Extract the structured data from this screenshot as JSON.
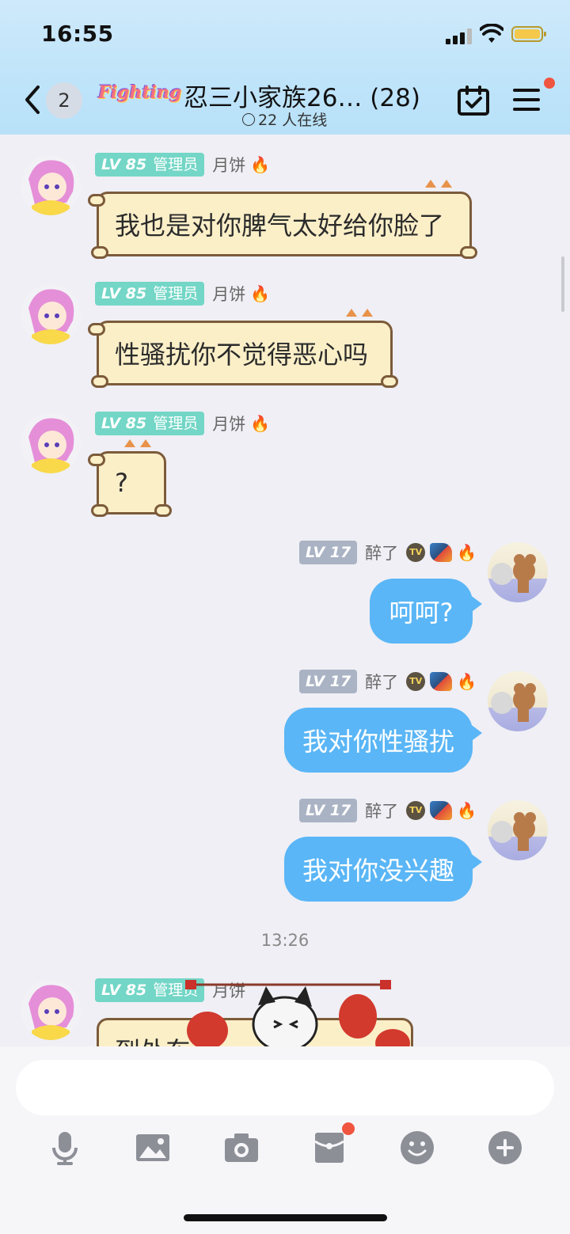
{
  "status_bar": {
    "time": "16:55"
  },
  "header": {
    "back_count": "2",
    "group_logo": "Fighting",
    "title": "忍三小家族26… (28)",
    "online": "22 人在线"
  },
  "messages": [
    {
      "side": "left",
      "level": "LV 85",
      "role": "管理员",
      "nick": "月饼",
      "text": "我也是对你脾气太好给你脸了"
    },
    {
      "side": "left",
      "level": "LV 85",
      "role": "管理员",
      "nick": "月饼",
      "text": "性骚扰你不觉得恶心吗"
    },
    {
      "side": "left",
      "level": "LV 85",
      "role": "管理员",
      "nick": "月饼",
      "text": "?"
    },
    {
      "side": "right",
      "level": "LV 17",
      "nick": "醉了",
      "text": "呵呵?"
    },
    {
      "side": "right",
      "level": "LV 17",
      "nick": "醉了",
      "text": "我对你性骚扰"
    },
    {
      "side": "right",
      "level": "LV 17",
      "nick": "醉了",
      "text": "我对你没兴趣"
    }
  ],
  "timestamp": "13:26",
  "last_message": {
    "level": "LV 85",
    "role": "管理员",
    "nick": "月饼",
    "text_partial": "到处东"
  },
  "badges": {
    "tv": "TV"
  },
  "colors": {
    "bubble_right": "#5ab6f6",
    "bubble_left": "#fbefc8",
    "admin_badge": "#73d6c6",
    "user_badge": "#aab3c4"
  },
  "toolbar": [
    "mic-icon",
    "image-icon",
    "camera-icon",
    "redpacket-icon",
    "emoji-icon",
    "plus-icon"
  ]
}
